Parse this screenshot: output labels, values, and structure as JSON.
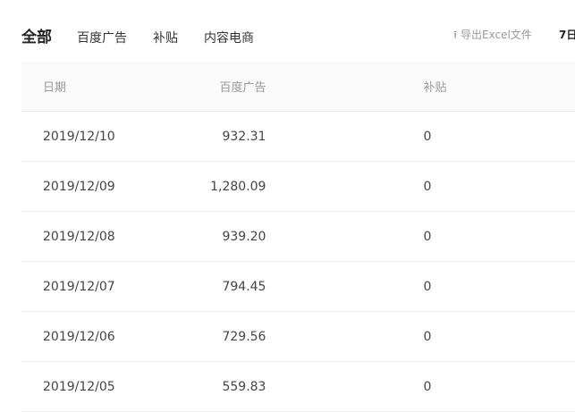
{
  "tabs": [
    "全部",
    "百度广告",
    "补贴",
    "内容电商"
  ],
  "export_label": "⭱ 导出Excel文件",
  "range_label": "7日",
  "table": {
    "headers": [
      "日期",
      "百度广告",
      "补贴"
    ],
    "rows": [
      [
        "2019/12/10",
        "932.31",
        "0"
      ],
      [
        "2019/12/09",
        "1,280.09",
        "0"
      ],
      [
        "2019/12/08",
        "939.20",
        "0"
      ],
      [
        "2019/12/07",
        "794.45",
        "0"
      ],
      [
        "2019/12/06",
        "729.56",
        "0"
      ],
      [
        "2019/12/05",
        "559.83",
        "0"
      ]
    ]
  }
}
